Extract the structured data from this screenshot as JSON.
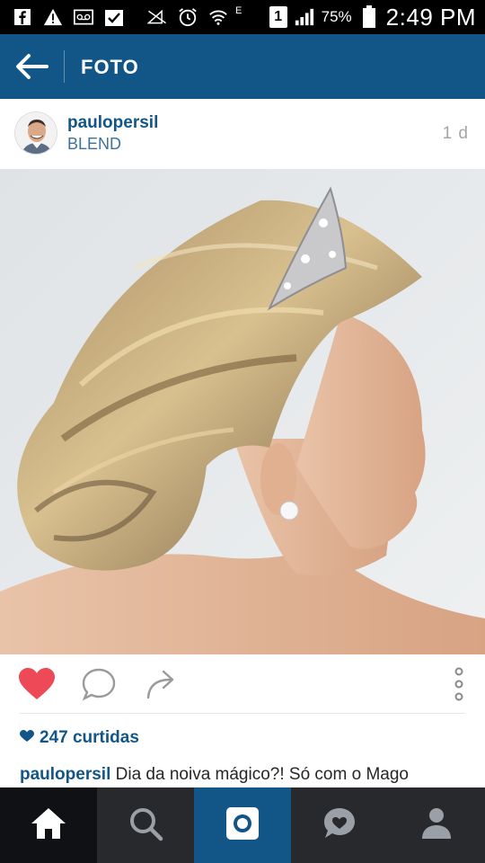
{
  "status_bar": {
    "battery": "75%",
    "time": "2:49 PM",
    "network": "E",
    "sim_slot": "1"
  },
  "header": {
    "title": "FOTO"
  },
  "post": {
    "username": "paulopersil",
    "location": "BLEND",
    "time_ago": "1 d",
    "likes_text": "247 curtidas",
    "caption_user": "paulopersil",
    "caption_text": "Dia da noiva mágico?! Só com o Mago"
  },
  "icons": {
    "status": [
      "facebook-icon",
      "alert-icon",
      "voicemail-icon",
      "checkbox-icon",
      "no-signal-icon",
      "alarm-icon",
      "wifi-icon",
      "signal-icon",
      "battery-icon"
    ],
    "actions": [
      "heart-icon",
      "comment-icon",
      "share-icon",
      "more-icon"
    ],
    "nav": [
      "home-icon",
      "search-icon",
      "camera-icon",
      "activity-icon",
      "profile-icon"
    ]
  },
  "colors": {
    "brand_blue": "#125688",
    "link_blue": "#3f729b",
    "like_red": "#ed4956",
    "nav_dark": "#27292c"
  }
}
